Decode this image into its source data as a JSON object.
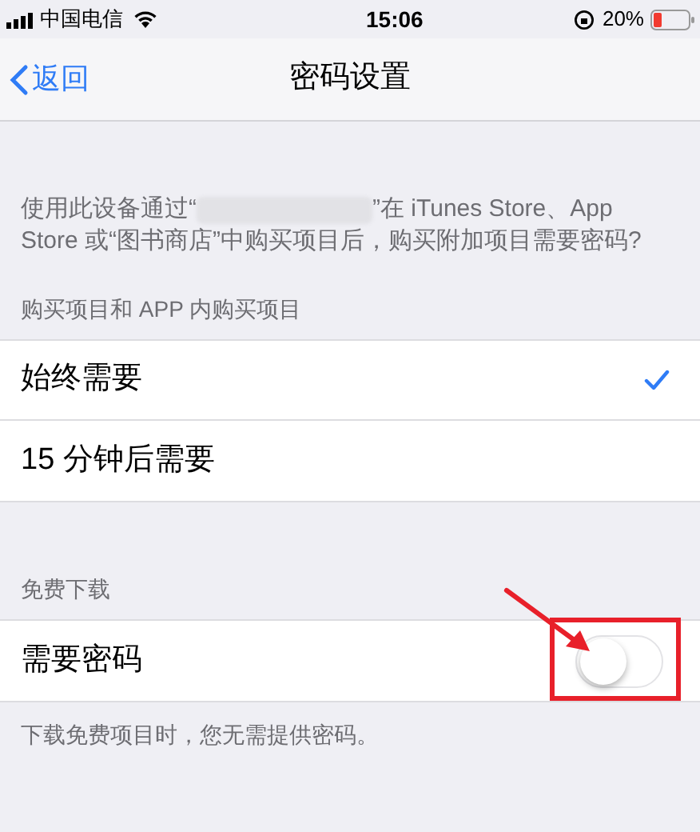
{
  "status_bar": {
    "carrier": "中国电信",
    "time": "15:06",
    "battery": "20%"
  },
  "nav": {
    "back": "返回",
    "title": "密码设置"
  },
  "intro": {
    "before": "使用此设备通过“",
    "after": "”在 iTunes Store、App Store 或“图书商店”中购买项目后，购买附加项目需要密码?"
  },
  "sections": [
    {
      "header": "购买项目和 APP 内购买项目",
      "rows": [
        {
          "kind": "choice",
          "label": "始终需要",
          "selected": true
        },
        {
          "kind": "choice",
          "label": "15 分钟后需要",
          "selected": false
        }
      ]
    },
    {
      "header": "免费下载",
      "rows": [
        {
          "kind": "toggle",
          "label": "需要密码",
          "on": false,
          "highlighted": true
        }
      ],
      "footer": "下载免费项目时，您无需提供密码。"
    }
  ]
}
